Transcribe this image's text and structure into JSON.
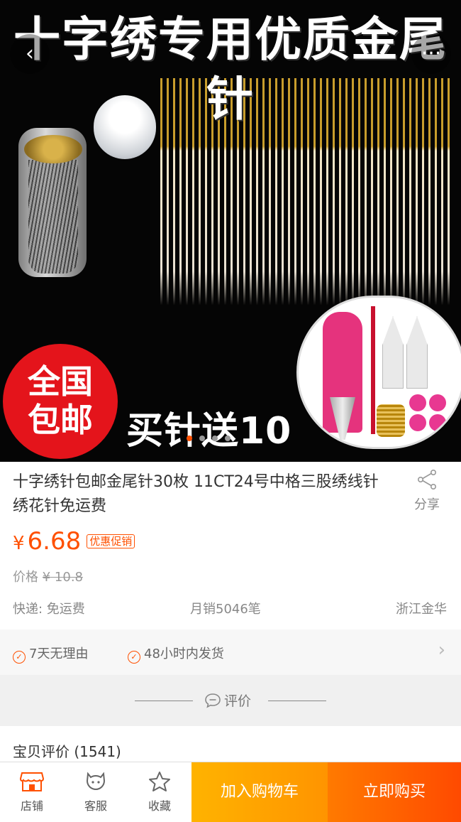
{
  "hero": {
    "title": "十字绣专用优质金尾针",
    "badge_line1": "全国",
    "badge_line2": "包邮",
    "promo_text": "买针送10",
    "back_icon": "chevron-left-icon",
    "more_icon": "ellipsis-icon"
  },
  "product": {
    "title": "十字绣针包邮金尾针30枚 11CT24号中格三股绣线针 绣花针免运费",
    "share_label": "分享",
    "currency": "¥",
    "price": "6.68",
    "promo_tag": "优惠促销",
    "original_label": "价格",
    "original_price": "¥ 10.8",
    "shipping": "快递: 免运费",
    "monthly_sales": "月销5046笔",
    "location": "浙江金华"
  },
  "guarantees": {
    "item1": "7天无理由",
    "item2": "48小时内发货"
  },
  "reviews": {
    "divider_label": "评价",
    "title": "宝贝评价",
    "count": "(1541)"
  },
  "bottom_bar": {
    "shop_label": "店铺",
    "service_label": "客服",
    "favorite_label": "收藏",
    "add_to_cart": "加入购物车",
    "buy_now": "立即购买"
  },
  "colors": {
    "accent": "#ff5000",
    "cart": "#ff9400",
    "buy": "#ff4a00"
  }
}
